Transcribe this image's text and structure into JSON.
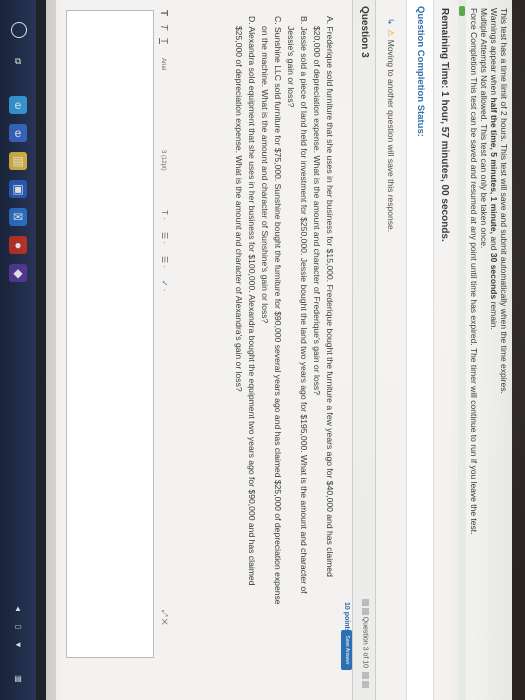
{
  "info": {
    "line1": "This test has a time limit of 2 hours. This test will save and submit automatically when the time expires.",
    "line2_pre": "Warnings appear when ",
    "line2_bold": "half the time, 5 minutes, 1 minute,",
    "line2_mid": " and ",
    "line2_bold2": "30 seconds",
    "line2_post": " remain.",
    "line3": "Multiple Attempts Not allowed. This test can only be taken once.",
    "line4": "Force Completion This test can be saved and resumed at any point until time has expired. The timer will continue to run if you leave the test."
  },
  "remaining_time": "Remaining Time: 1 hour, 57 minutes, 00 seconds.",
  "status_title": "Question Completion Status:",
  "move_warning": "Moving to another question will save this response.",
  "question": {
    "title": "Question 3",
    "counter": "Question 3 of 10",
    "points": "10 points",
    "save_label": "Save Answer",
    "items": [
      "A. Frederique sold furniture that she uses in her business for $15,000. Frederique bought the furniture a few years ago for $40,000 and has claimed",
      "$20,000 of depreciation expense. What is the amount and character of Frederique's gain or loss?",
      "B. Jessie sold a piece of land held for investment for $250,000. Jessie bought the land two years ago for $195,000. What is the amount and character of",
      "Jessie's gain or loss?",
      "C. Sunshine LLC sold furniture for $75,000. Sunshine bought the furniture for $90,000 several years ago and has claimed $25,000 of depreciation expense",
      "on the machine. What is the amount and character of Sunshine's gain or loss?",
      "D. Alexandra sold equipment that she uses in her business for $100,000. Alexandra bought the equipment two years ago for $90,000 and has claimed",
      "$25,000 of depreciation expense. What is the amount and character of Alexandra's gain or loss?"
    ]
  },
  "editor": {
    "font": "Arial",
    "size": "3 (12pt)"
  },
  "colors": {
    "accent": "#2a68a6",
    "warning": "#e3a219",
    "timer_green": "#58a94b"
  }
}
